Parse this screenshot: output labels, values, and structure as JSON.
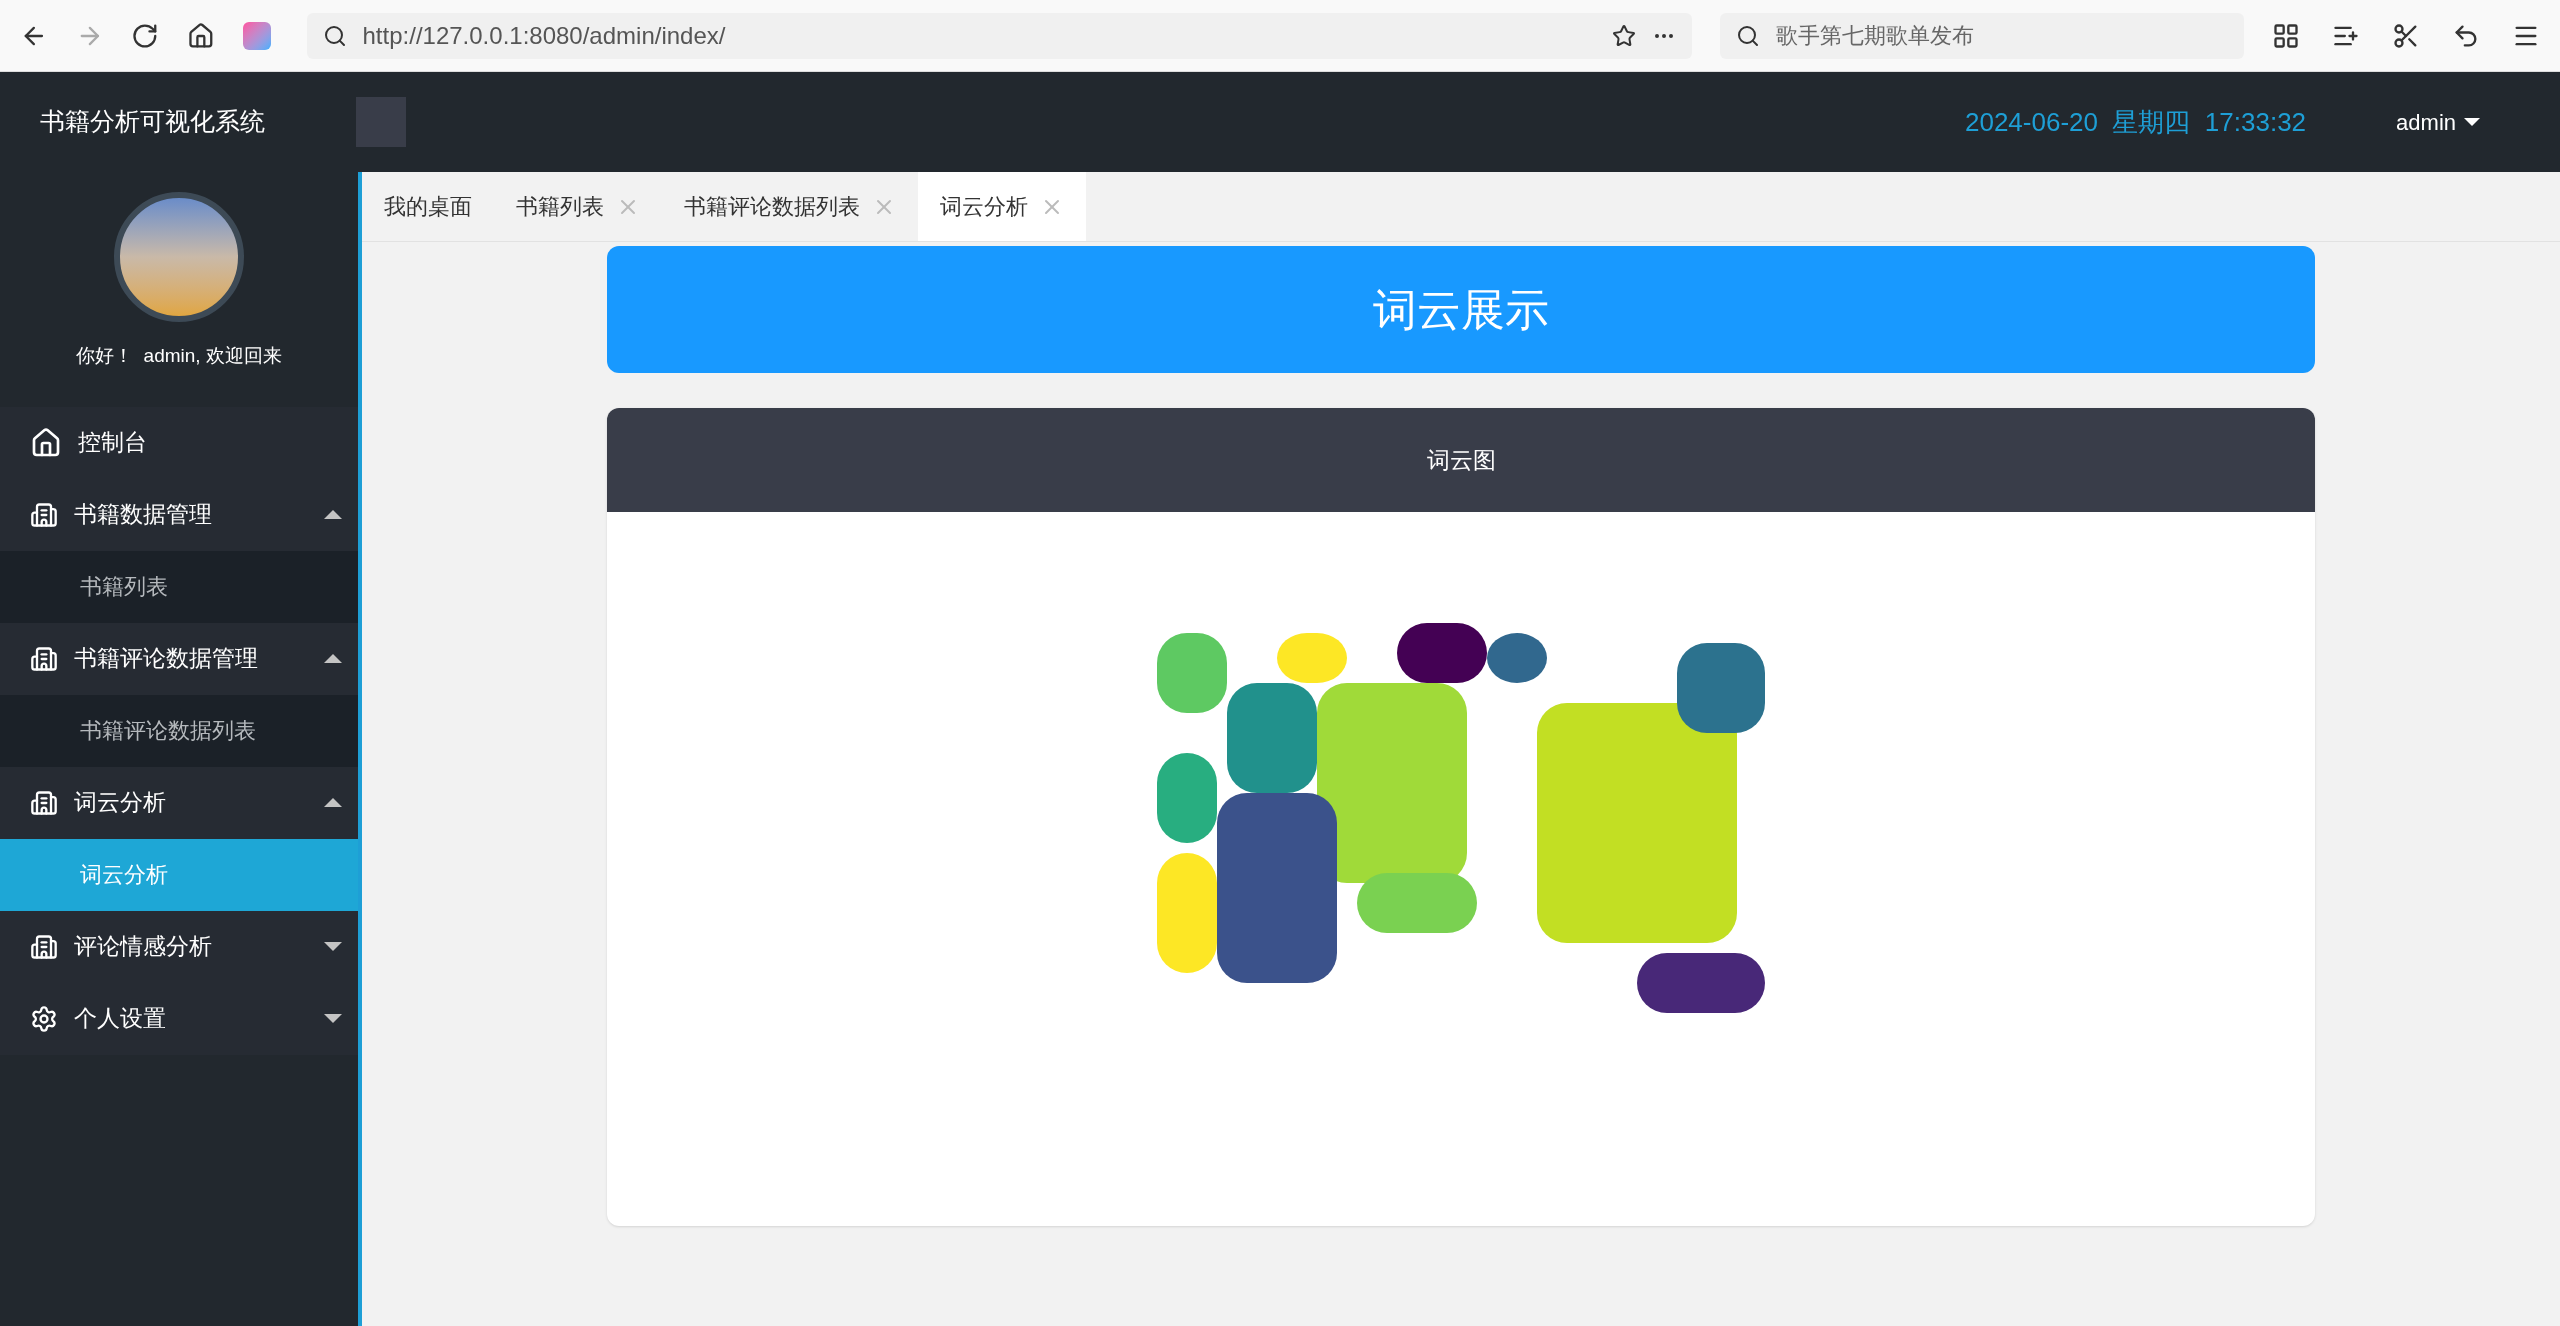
{
  "browser": {
    "url": "http://127.0.0.1:8080/admin/index/",
    "search": {
      "placeholder": "歌手第七期歌单发布"
    }
  },
  "header": {
    "title": "书籍分析可视化系统",
    "datetime": "2024-06-20  星期四  17:33:32",
    "user": "admin"
  },
  "sidebar": {
    "greeting": "你好！  admin, 欢迎回来",
    "items": [
      {
        "kind": "home",
        "label": "控制台"
      },
      {
        "kind": "group",
        "label": "书籍数据管理",
        "expanded": true,
        "children": [
          {
            "label": "书籍列表",
            "selected": false
          }
        ]
      },
      {
        "kind": "group",
        "label": "书籍评论数据管理",
        "expanded": true,
        "children": [
          {
            "label": "书籍评论数据列表",
            "selected": false
          }
        ]
      },
      {
        "kind": "group",
        "label": "词云分析",
        "expanded": true,
        "children": [
          {
            "label": "词云分析",
            "selected": true
          }
        ]
      },
      {
        "kind": "group",
        "label": "评论情感分析",
        "expanded": false
      },
      {
        "kind": "settings",
        "label": "个人设置",
        "expanded": false
      }
    ]
  },
  "tabs": [
    {
      "label": "我的桌面",
      "closable": false,
      "selected": false
    },
    {
      "label": "书籍列表",
      "closable": true,
      "selected": false
    },
    {
      "label": "书籍评论数据列表",
      "closable": true,
      "selected": false
    },
    {
      "label": "词云分析",
      "closable": true,
      "selected": true
    }
  ],
  "banner": {
    "title": "词云展示"
  },
  "card": {
    "title": "词云图"
  }
}
